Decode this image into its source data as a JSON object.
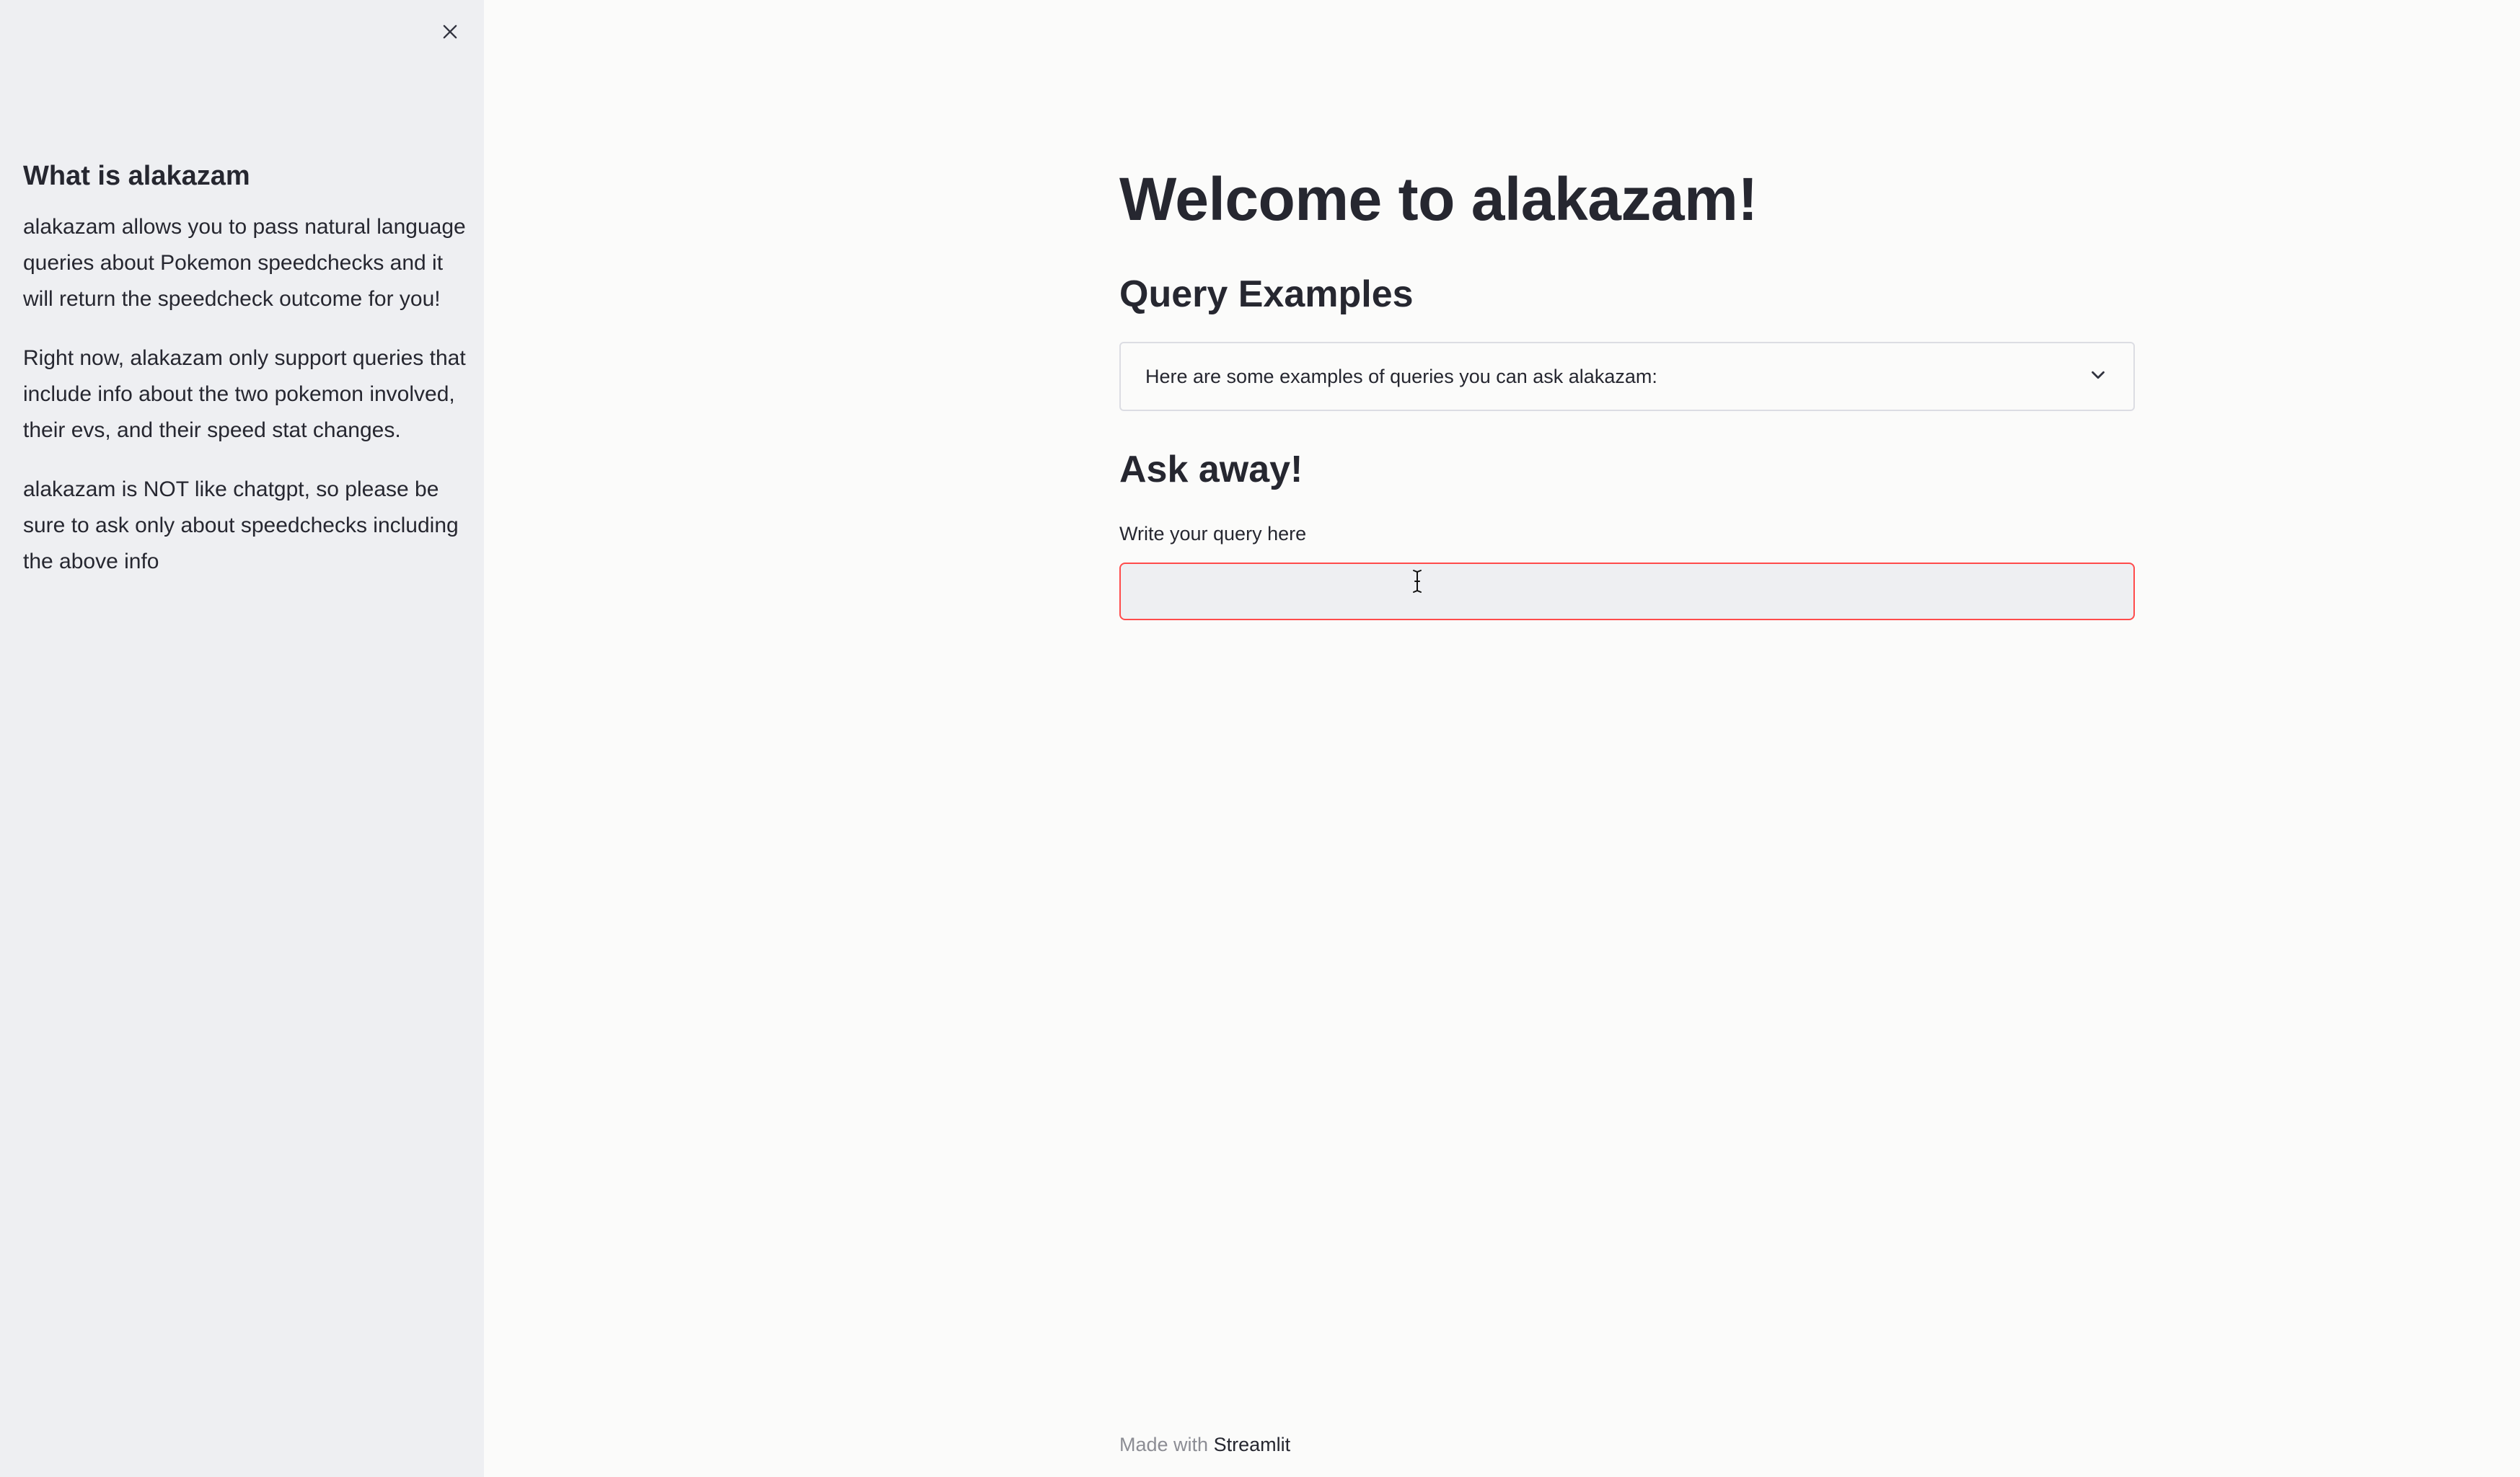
{
  "sidebar": {
    "close_icon": "close-icon",
    "heading": "What is alakazam",
    "paragraphs": [
      "alakazam allows you to pass natural language queries about Pokemon speedchecks and it will return the speedcheck outcome for you!",
      "Right now, alakazam only support queries that include info about the two pokemon involved, their evs, and their speed stat changes.",
      "alakazam is NOT like chatgpt, so please be sure to ask only about speedchecks including the above info"
    ]
  },
  "main": {
    "title": "Welcome to alakazam!",
    "examples_heading": "Query Examples",
    "expander": {
      "label": "Here are some examples of queries you can ask alakazam:",
      "icon": "chevron-down-icon"
    },
    "ask_heading": "Ask away!",
    "query": {
      "label": "Write your query here",
      "value": "",
      "placeholder": ""
    }
  },
  "footer": {
    "prefix": "Made with",
    "link": "Streamlit"
  },
  "colors": {
    "sidebar_bg": "#eeeff2",
    "main_bg": "#fbfbfa",
    "input_focus_border": "#ff4b4b",
    "text": "#262730"
  }
}
